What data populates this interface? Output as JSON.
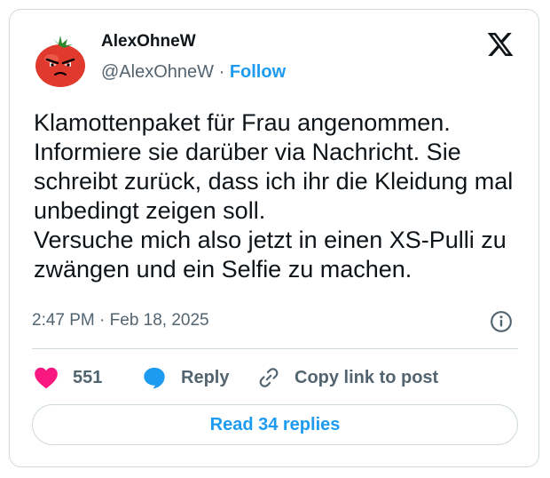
{
  "author": {
    "display_name": "AlexOhneW",
    "handle": "@AlexOhneW",
    "separator": "·",
    "follow_label": "Follow"
  },
  "tweet": {
    "text": "Klamottenpaket für Frau angenommen.\nInformiere sie darüber via Nachricht. Sie schreibt zurück, dass ich ihr die Kleidung mal unbedingt zeigen soll.\nVersuche mich also jetzt in einen XS-Pulli zu zwängen und ein Selfie zu machen.",
    "timestamp": "2:47 PM · Feb 18, 2025"
  },
  "actions": {
    "like_count": "551",
    "reply_label": "Reply",
    "copy_label": "Copy link to post"
  },
  "read_replies_label": "Read 34 replies",
  "icons": {
    "avatar": "tomato-avatar",
    "logo": "x-logo-icon",
    "info": "info-icon",
    "like": "heart-icon",
    "reply": "speech-bubble-icon",
    "copy": "link-icon"
  },
  "colors": {
    "accent": "#1d9bf0",
    "like": "#f91880",
    "text": "#0f1419",
    "muted": "#536471",
    "border": "#cfd9de"
  }
}
